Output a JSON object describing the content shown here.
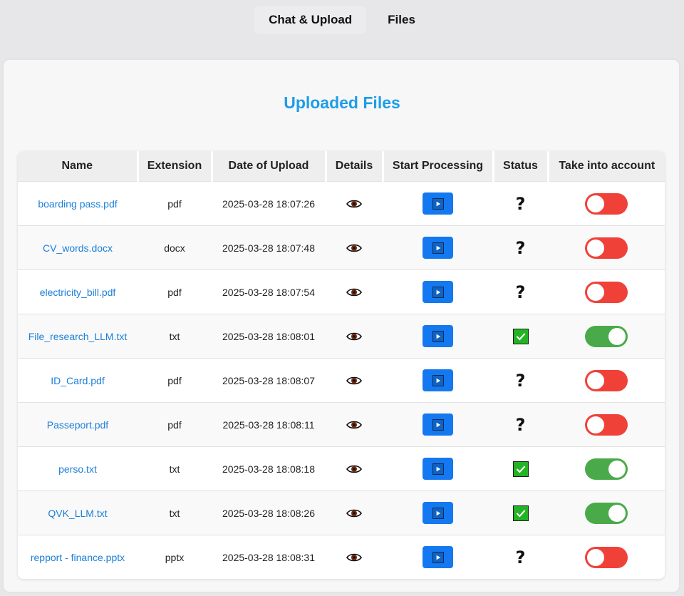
{
  "tabs": [
    {
      "label": "Chat & Upload",
      "active": true
    },
    {
      "label": "Files",
      "active": false
    }
  ],
  "page_title": "Uploaded Files",
  "table": {
    "headers": [
      "Name",
      "Extension",
      "Date of Upload",
      "Details",
      "Start Processing",
      "Status",
      "Take into account"
    ],
    "rows": [
      {
        "name": "boarding pass.pdf",
        "extension": "pdf",
        "date": "2025-03-28 18:07:26",
        "status": "unknown",
        "take_into_account": false
      },
      {
        "name": "CV_words.docx",
        "extension": "docx",
        "date": "2025-03-28 18:07:48",
        "status": "unknown",
        "take_into_account": false
      },
      {
        "name": "electricity_bill.pdf",
        "extension": "pdf",
        "date": "2025-03-28 18:07:54",
        "status": "unknown",
        "take_into_account": false
      },
      {
        "name": "File_research_LLM.txt",
        "extension": "txt",
        "date": "2025-03-28 18:08:01",
        "status": "processed",
        "take_into_account": true
      },
      {
        "name": "ID_Card.pdf",
        "extension": "pdf",
        "date": "2025-03-28 18:08:07",
        "status": "unknown",
        "take_into_account": false
      },
      {
        "name": "Passeport.pdf",
        "extension": "pdf",
        "date": "2025-03-28 18:08:11",
        "status": "unknown",
        "take_into_account": false
      },
      {
        "name": "perso.txt",
        "extension": "txt",
        "date": "2025-03-28 18:08:18",
        "status": "processed",
        "take_into_account": true
      },
      {
        "name": "QVK_LLM.txt",
        "extension": "txt",
        "date": "2025-03-28 18:08:26",
        "status": "processed",
        "take_into_account": true
      },
      {
        "name": "repport - finance.pptx",
        "extension": "pptx",
        "date": "2025-03-28 18:08:31",
        "status": "unknown",
        "take_into_account": false
      }
    ]
  },
  "icons": {
    "details": "eye-icon",
    "start_processing": "play-icon",
    "status_unknown": "question-mark-icon",
    "status_processed": "check-mark-icon"
  },
  "colors": {
    "title": "#1e9de8",
    "link": "#1a7fd8",
    "play_button": "#1478f0",
    "toggle_on": "#4aaa4a",
    "toggle_off": "#f04138",
    "check": "#22b422"
  }
}
